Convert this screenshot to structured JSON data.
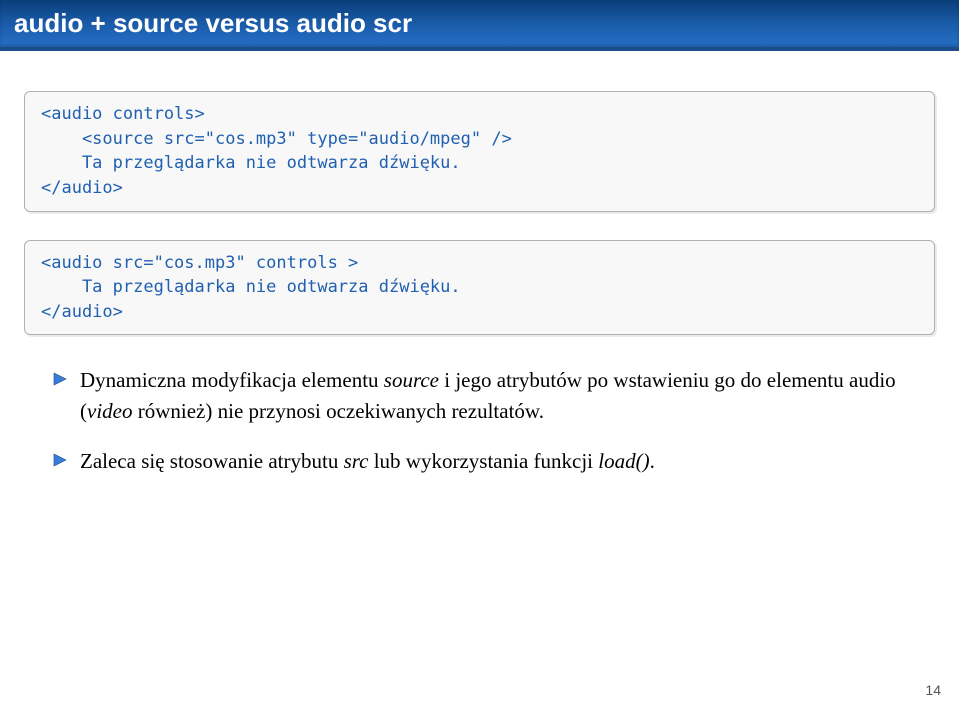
{
  "header": {
    "title": "audio + source versus audio scr"
  },
  "code1": {
    "line1": "<audio controls>",
    "line2": "    <source src=\"cos.mp3\" type=\"audio/mpeg\" />",
    "line3": "    Ta przeglądarka nie odtwarza dźwięku.",
    "line4": "</audio>"
  },
  "code2": {
    "line1": "<audio src=\"cos.mp3\" controls >",
    "line2": "    Ta przeglądarka nie odtwarza dźwięku.",
    "line3": "</audio>"
  },
  "bullets": {
    "b1_pre": "Dynamiczna modyfikacja elementu ",
    "b1_it1": "source",
    "b1_mid1": " i jego atrybutów po wstawieniu go do elementu audio (",
    "b1_it2": "video",
    "b1_mid2": " również) nie przynosi oczekiwanych rezultatów.",
    "b2_pre": "Zaleca się stosowanie atrybutu ",
    "b2_it1": "src",
    "b2_mid": " lub wykorzystania funkcji ",
    "b2_it2": "load()",
    "b2_post": "."
  },
  "page": "14"
}
